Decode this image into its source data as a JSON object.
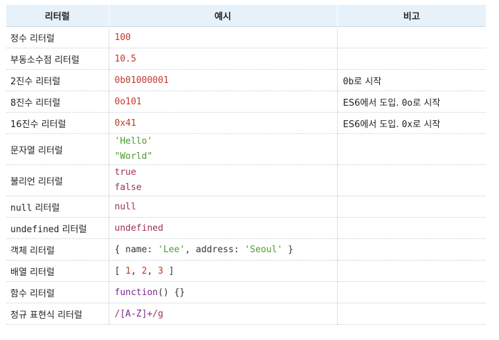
{
  "headers": [
    "리터럴",
    "예시",
    "비고"
  ],
  "rows": [
    {
      "name": "정수 리터럴",
      "example": [
        "100"
      ],
      "kind": "num",
      "note": ""
    },
    {
      "name": "부동소수점 리터럴",
      "example": [
        "10.5"
      ],
      "kind": "num",
      "note": ""
    },
    {
      "name": "2진수 리터럴",
      "example": [
        "0b01000001"
      ],
      "kind": "num",
      "note_code": "0b",
      "note_rest": "로 시작"
    },
    {
      "name": "8진수 리터럴",
      "example": [
        "0o101"
      ],
      "kind": "num",
      "note_pre": "ES6에서 도입. ",
      "note_code": "0o",
      "note_rest": "로 시작"
    },
    {
      "name": "16진수 리터럴",
      "example": [
        "0x41"
      ],
      "kind": "num",
      "note_pre": "ES6에서 도입. ",
      "note_code": "0x",
      "note_rest": "로 시작"
    },
    {
      "name": "문자열 리터럴",
      "example": [
        "'Hello'",
        "\"World\""
      ],
      "kind": "str",
      "note": ""
    },
    {
      "name": "불리언 리터럴",
      "example": [
        "true",
        "false"
      ],
      "kind": "kw",
      "note": ""
    },
    {
      "name_code": "null",
      "name_rest": " 리터럴",
      "example": [
        "null"
      ],
      "kind": "kw",
      "note": ""
    },
    {
      "name_code": "undefined",
      "name_rest": " 리터럴",
      "example": [
        "undefined"
      ],
      "kind": "kw",
      "note": ""
    },
    {
      "name": "객체 리터럴",
      "object_parts": [
        "{ name: ",
        "'Lee'",
        ", address: ",
        "'Seoul'",
        " }"
      ],
      "note": ""
    },
    {
      "name": "배열 리터럴",
      "array_parts": [
        "[ ",
        "1",
        ", ",
        "2",
        ", ",
        "3",
        " ]"
      ],
      "note": ""
    },
    {
      "name": "함수 리터럴",
      "function_parts": [
        "function",
        "() {}"
      ],
      "note": ""
    },
    {
      "name": "정규 표현식 리터럴",
      "regex_parts": [
        "/",
        "[A-Z]+",
        "/g"
      ],
      "note": ""
    }
  ],
  "colors": {
    "header_bg": "#e6f1fa",
    "number": "#c0392b",
    "string": "#4e9a2e",
    "keyword": "#a0305a"
  }
}
